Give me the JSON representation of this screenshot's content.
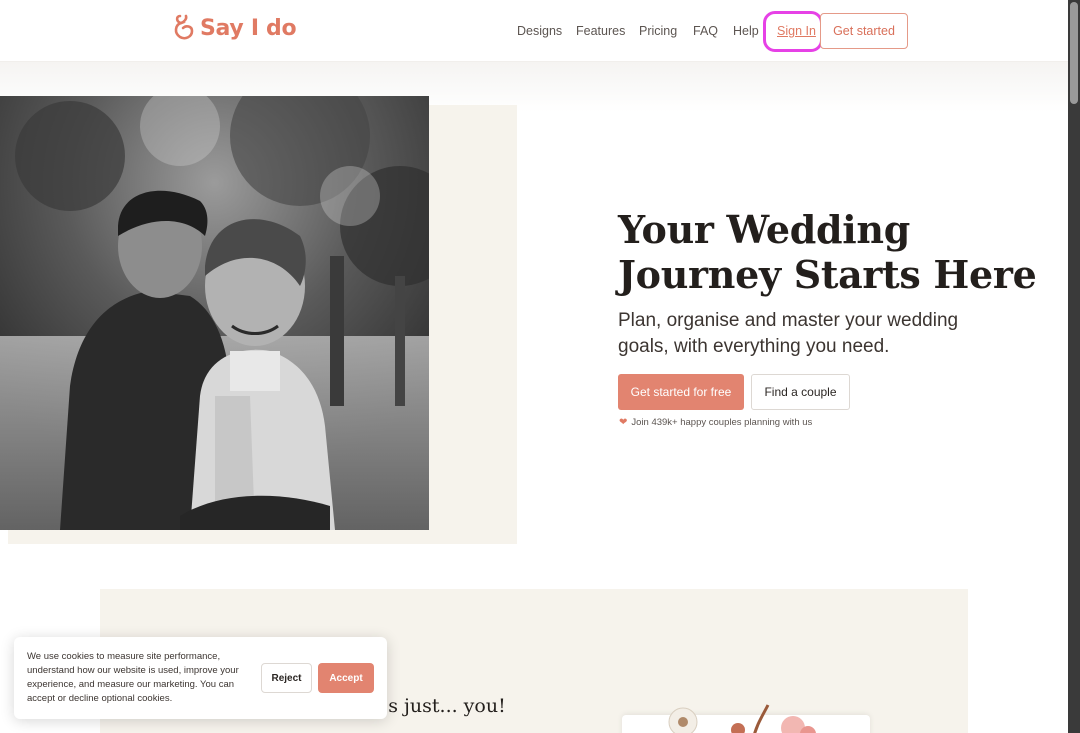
{
  "header": {
    "logo_text": "Say I do",
    "nav": {
      "designs": "Designs",
      "features": "Features",
      "pricing": "Pricing",
      "faq": "FAQ",
      "help": "Help",
      "sign_in": "Sign In"
    },
    "cta_label": "Get started"
  },
  "hero": {
    "title_line1": "Your Wedding",
    "title_line2": "Journey Starts Here",
    "subtitle": "Plan, organise and master your wedding goals, with everything you need.",
    "primary_button": "Get started for free",
    "secondary_button": "Find a couple",
    "social_proof": "Join 439k+ happy couples planning with us"
  },
  "section2": {
    "visible_text": "'s just... you!"
  },
  "cookie_banner": {
    "message": "We use cookies to measure site performance, understand how our website is used, improve your experience, and measure our marketing. You can accept or decline optional cookies.",
    "reject_label": "Reject",
    "accept_label": "Accept"
  },
  "colors": {
    "brand": "#e07a63",
    "primary_button": "#e28470",
    "cream": "#f6f3ec",
    "focus_ring": "#e641e6"
  },
  "icons": {
    "logo": "say-i-do-logo-icon",
    "social_proof": "heart-icon"
  }
}
